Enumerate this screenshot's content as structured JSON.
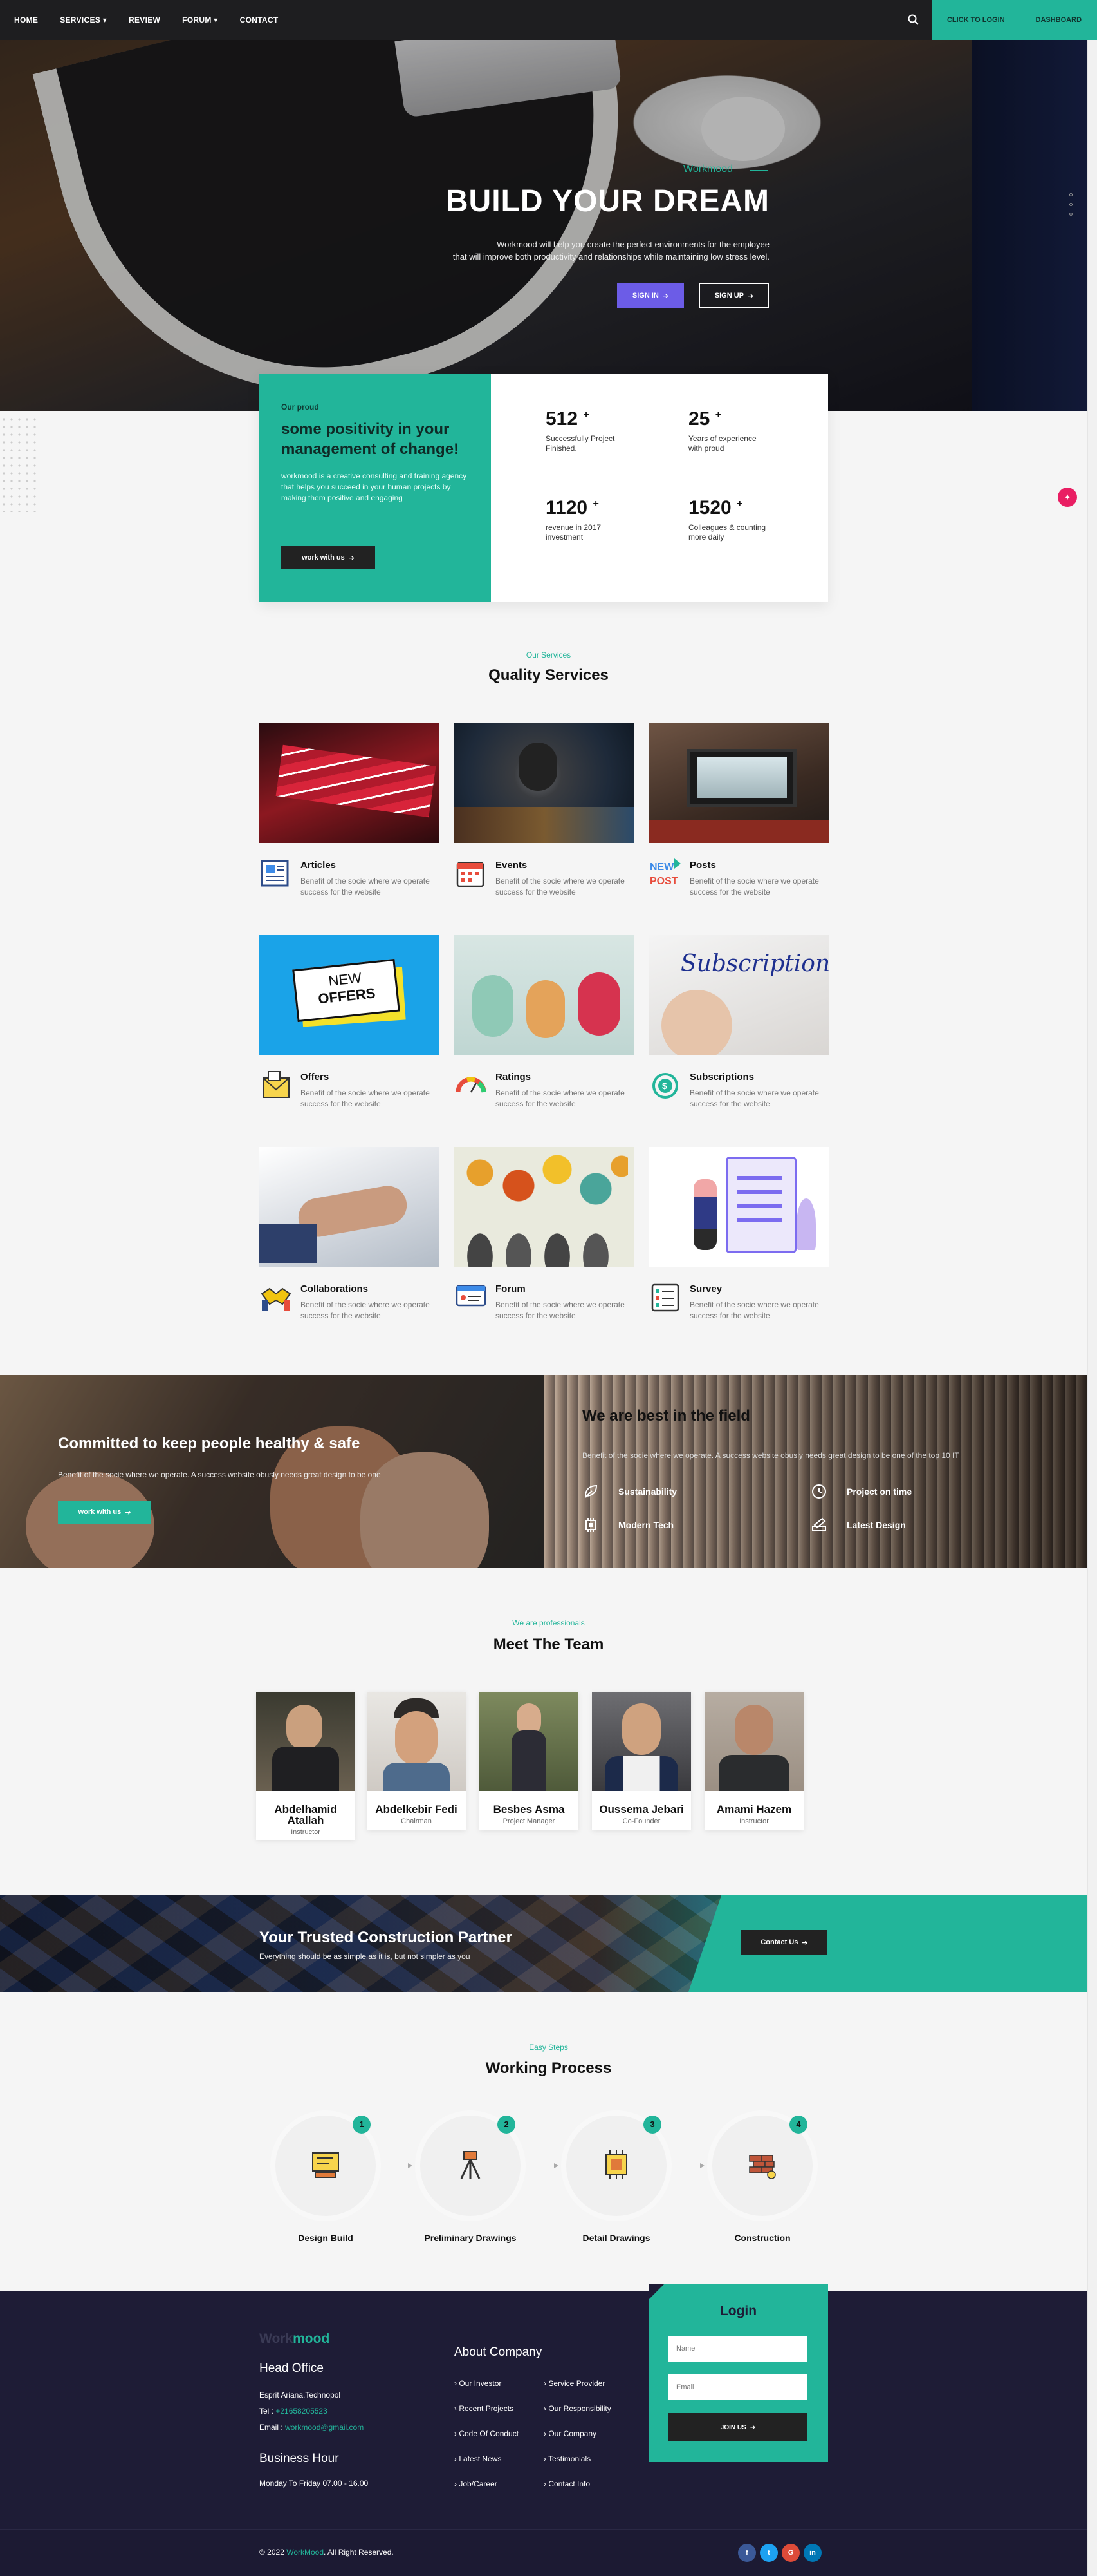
{
  "nav": {
    "links": [
      "HOME",
      "SERVICES ▾",
      "REVIEW",
      "FORUM ▾",
      "CONTACT"
    ],
    "login": "CLICK TO LOGIN",
    "dashboard": "DASHBOARD"
  },
  "hero": {
    "eyebrow": "Workmood",
    "title": "BUILD YOUR DREAM",
    "text_line1": "Workmood will help you create the perfect environments for the employee",
    "text_line2": "that will improve both productivity and relationships while maintaining low stress level.",
    "signin": "SIGN IN",
    "signup": "SIGN UP"
  },
  "stats": {
    "eyebrow": "Our proud",
    "title": "some positivity in your management of change!",
    "text": "workmood is a creative consulting and training agency that helps you succeed in your human projects by making them positive and engaging",
    "button": "work with us",
    "items": [
      {
        "num": "512",
        "label": "Successfully Project Finished."
      },
      {
        "num": "25",
        "label": "Years of experience with proud"
      },
      {
        "num": "1120",
        "label": "revenue in 2017 investment"
      },
      {
        "num": "1520",
        "label": "Colleagues & counting more daily"
      }
    ],
    "plus": "+"
  },
  "services": {
    "eyebrow": "Our Services",
    "title": "Quality Services",
    "desc": "Benefit of the socie where we operate success for the website",
    "items": [
      {
        "name": "Articles"
      },
      {
        "name": "Events"
      },
      {
        "name": "Posts"
      },
      {
        "name": "Offers"
      },
      {
        "name": "Ratings"
      },
      {
        "name": "Subscriptions"
      },
      {
        "name": "Collaborations"
      },
      {
        "name": "Forum"
      },
      {
        "name": "Survey"
      }
    ],
    "img_new": "NEW",
    "img_offers": "OFFERS",
    "img_subscription": "Subscription",
    "posts_icon_text": "NEW POST"
  },
  "commit": {
    "title": "Committed to keep people healthy & safe",
    "text": "Benefit of the socie where we operate. A success website obusly needs great design to be one",
    "button": "work with us",
    "best_title": "We are best in the field",
    "best_text": "Benefit of the socie where we operate. A success website obusly needs great design to be one of the top 10 IT",
    "features": [
      "Sustainability",
      "Project on time",
      "Modern Tech",
      "Latest Design"
    ]
  },
  "team": {
    "eyebrow": "We are professionals",
    "title": "Meet The Team",
    "members": [
      {
        "name": "Abdelhamid Atallah",
        "role": "Instructor"
      },
      {
        "name": "Abdelkebir Fedi",
        "role": "Chairman"
      },
      {
        "name": "Besbes Asma",
        "role": "Project Manager"
      },
      {
        "name": "Oussema Jebari",
        "role": "Co-Founder"
      },
      {
        "name": "Amami Hazem",
        "role": "Instructor"
      }
    ]
  },
  "partner": {
    "title": "Your Trusted Construction Partner",
    "text": "Everything should be as simple as it is, but not simpler as you",
    "button": "Contact Us"
  },
  "process": {
    "eyebrow": "Easy Steps",
    "title": "Working Process",
    "steps": [
      {
        "num": "1",
        "label": "Design Build"
      },
      {
        "num": "2",
        "label": "Preliminary Drawings"
      },
      {
        "num": "3",
        "label": "Detail Drawings"
      },
      {
        "num": "4",
        "label": "Construction"
      }
    ]
  },
  "footer": {
    "logo_a": "Work",
    "logo_b": "mood",
    "head_office": "Head Office",
    "address": "Esprit Ariana,Technopol",
    "tel_label": "Tel : ",
    "tel": "+21658205523",
    "email_label": "Email : ",
    "email": "workmood@gmail.com",
    "business_hour": "Business Hour",
    "hours": "Monday To Friday 07.00 - 16.00",
    "about": "About Company",
    "links_col1": [
      "Our Investor",
      "Recent Projects",
      "Code Of Conduct",
      "Latest News",
      "Job/Career"
    ],
    "links_col2": [
      "Service Provider",
      "Our Responsibility",
      "Our Company",
      "Testimonials",
      "Contact Info"
    ],
    "login_title": "Login",
    "name_placeholder": "Name",
    "email_placeholder": "Email",
    "join": "JOIN US",
    "copyright_a": "© 2022 ",
    "copyright_b": "WorkMood",
    "copyright_c": ". All Right Reserved.",
    "socials": [
      {
        "name": "f",
        "color": "#3b5998"
      },
      {
        "name": "t",
        "color": "#1da1f2"
      },
      {
        "name": "G",
        "color": "#dd4b39"
      },
      {
        "name": "in",
        "color": "#0077b5"
      }
    ]
  },
  "colors": {
    "accent": "#22b59a",
    "purple": "#6c5ce7",
    "dark": "#1e1c36",
    "pink": "#e91e63"
  }
}
